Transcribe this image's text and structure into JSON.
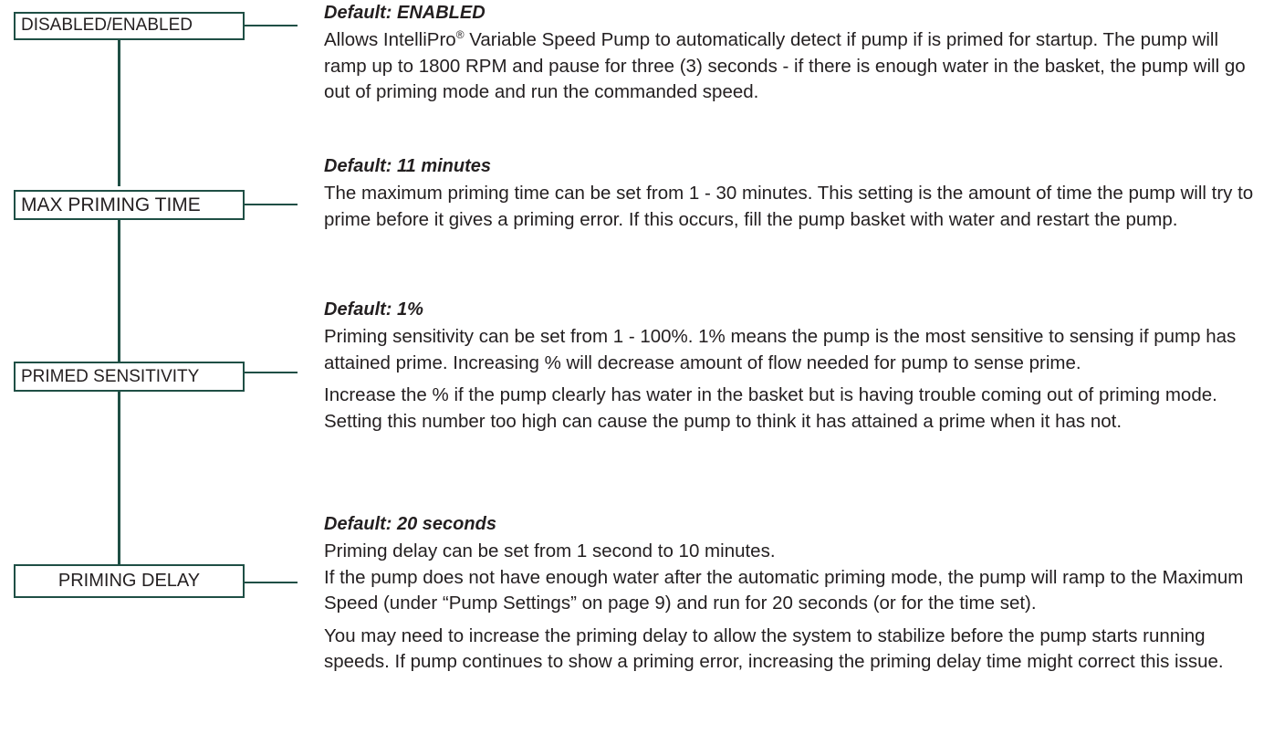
{
  "labels": {
    "disabled_enabled": "DISABLED/ENABLED",
    "max_priming_time": "MAX PRIMING TIME",
    "primed_sensitivity": "PRIMED SENSITIVITY",
    "priming_delay": "PRIMING DELAY"
  },
  "sections": {
    "enabled": {
      "heading": "Default: ENABLED",
      "para_pre": "Allows IntelliPro",
      "reg": "®",
      "para_post": " Variable Speed Pump to automatically detect if pump if is primed for startup. The pump will ramp up to 1800 RPM and pause for three (3) seconds - if there is enough water in the basket, the pump will go out of priming mode and run the commanded speed."
    },
    "max_time": {
      "heading": "Default: 11 minutes",
      "para": "The maximum priming time can be set from 1 - 30 minutes. This setting is the amount of time the pump will try to prime before it gives a priming error. If this occurs, fill the pump basket with water and restart the pump."
    },
    "sensitivity": {
      "heading": "Default: 1%",
      "para1": "Priming sensitivity can be set from 1 - 100%. 1% means the pump is the most sensitive to sensing if pump has attained prime. Increasing % will decrease amount of flow needed for pump to sense prime.",
      "para2": "Increase the % if the pump clearly has water in the basket but is having trouble coming out of priming mode. Setting this number too high can cause the pump to think it has attained a prime when it has not."
    },
    "delay": {
      "heading": "Default: 20 seconds",
      "para1": "Priming delay can be set from 1 second to 10 minutes.",
      "para2": "If the pump does not have enough water after the automatic priming mode, the pump will ramp to the Maximum Speed (under “Pump Settings” on page 9) and run for 20 seconds (or for the time set).",
      "para3": "You may need to increase the priming delay to allow the system to stabilize before the pump starts running speeds. If pump continues to show a priming error, increasing the priming delay time might correct this issue."
    }
  },
  "colors": {
    "accent": "#1f4f45",
    "text": "#231f20"
  }
}
